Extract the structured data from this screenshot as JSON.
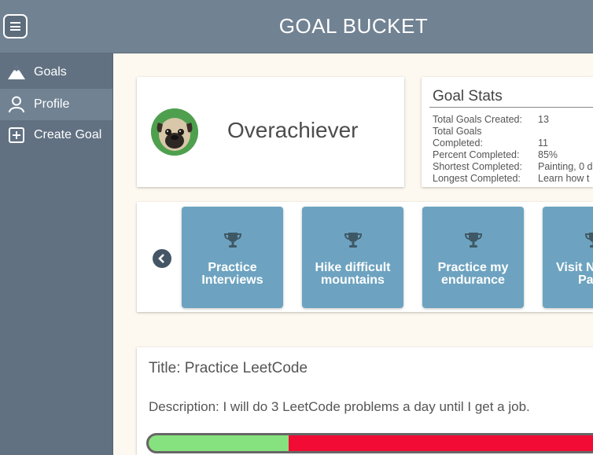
{
  "app": {
    "title": "GOAL BUCKET"
  },
  "sidebar": {
    "items": [
      {
        "label": "Goals",
        "icon": "mountain-icon",
        "active": false
      },
      {
        "label": "Profile",
        "icon": "user-icon",
        "active": true
      },
      {
        "label": "Create Goal",
        "icon": "plus-square-icon",
        "active": false
      }
    ]
  },
  "profile": {
    "username": "Overachiever",
    "avatar_icon": "pug-avatar"
  },
  "stats": {
    "title": "Goal Stats",
    "rows": [
      {
        "label": "Total Goals Created:",
        "value": "13"
      },
      {
        "label": "Total Goals Completed:",
        "value": "11"
      },
      {
        "label": "Percent Completed:",
        "value": "85%"
      },
      {
        "label": "Shortest Completed:",
        "value": "Painting, 0 d"
      },
      {
        "label": "Longest Completed:",
        "value": "Learn how t"
      }
    ]
  },
  "carousel": {
    "prev_icon": "chevron-left-circle-icon",
    "tiles": [
      {
        "label_line1": "Practice",
        "label_line2": "Interviews",
        "icon": "trophy-icon"
      },
      {
        "label_line1": "Hike difficult",
        "label_line2": "mountains",
        "icon": "trophy-icon"
      },
      {
        "label_line1": "Practice my",
        "label_line2": "endurance",
        "icon": "trophy-icon"
      },
      {
        "label_line1": "Visit N",
        "label_line2": "Pa",
        "icon": "trophy-icon"
      }
    ]
  },
  "goal_detail": {
    "title": "Title: Practice LeetCode",
    "description": "Description: I will do 3 LeetCode problems a day until I get a job.",
    "progress": 0.3,
    "colors": {
      "complete": "#86e27f",
      "remaining": "#f10b35"
    }
  },
  "colors": {
    "header": "#718293",
    "sidebar": "#617182",
    "tile": "#6da3c0",
    "background": "#fdf9f0"
  }
}
